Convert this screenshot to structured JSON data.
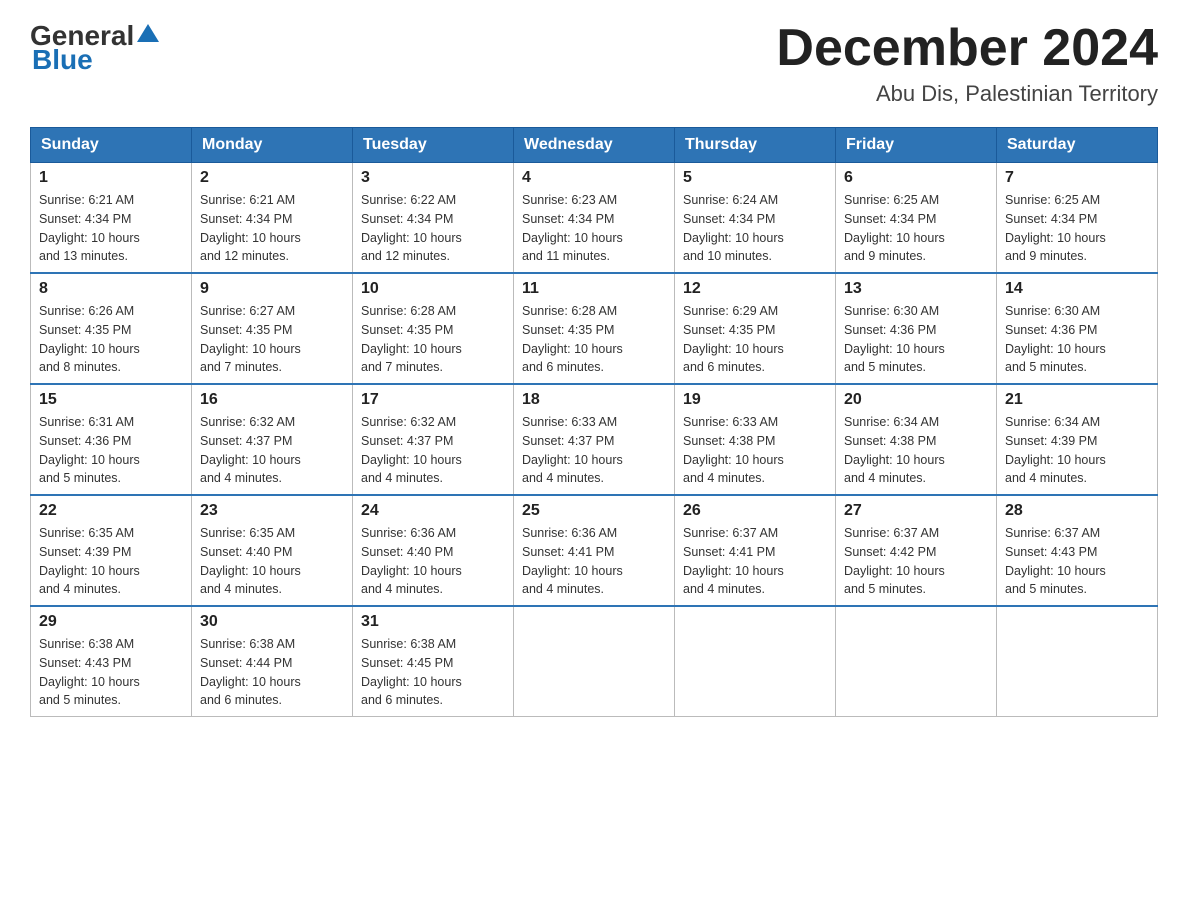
{
  "header": {
    "logo": {
      "text_general": "General",
      "text_blue": "Blue"
    },
    "title": "December 2024",
    "location": "Abu Dis, Palestinian Territory"
  },
  "calendar": {
    "days_of_week": [
      "Sunday",
      "Monday",
      "Tuesday",
      "Wednesday",
      "Thursday",
      "Friday",
      "Saturday"
    ],
    "weeks": [
      [
        {
          "day": "1",
          "sunrise": "6:21 AM",
          "sunset": "4:34 PM",
          "daylight": "10 hours and 13 minutes."
        },
        {
          "day": "2",
          "sunrise": "6:21 AM",
          "sunset": "4:34 PM",
          "daylight": "10 hours and 12 minutes."
        },
        {
          "day": "3",
          "sunrise": "6:22 AM",
          "sunset": "4:34 PM",
          "daylight": "10 hours and 12 minutes."
        },
        {
          "day": "4",
          "sunrise": "6:23 AM",
          "sunset": "4:34 PM",
          "daylight": "10 hours and 11 minutes."
        },
        {
          "day": "5",
          "sunrise": "6:24 AM",
          "sunset": "4:34 PM",
          "daylight": "10 hours and 10 minutes."
        },
        {
          "day": "6",
          "sunrise": "6:25 AM",
          "sunset": "4:34 PM",
          "daylight": "10 hours and 9 minutes."
        },
        {
          "day": "7",
          "sunrise": "6:25 AM",
          "sunset": "4:34 PM",
          "daylight": "10 hours and 9 minutes."
        }
      ],
      [
        {
          "day": "8",
          "sunrise": "6:26 AM",
          "sunset": "4:35 PM",
          "daylight": "10 hours and 8 minutes."
        },
        {
          "day": "9",
          "sunrise": "6:27 AM",
          "sunset": "4:35 PM",
          "daylight": "10 hours and 7 minutes."
        },
        {
          "day": "10",
          "sunrise": "6:28 AM",
          "sunset": "4:35 PM",
          "daylight": "10 hours and 7 minutes."
        },
        {
          "day": "11",
          "sunrise": "6:28 AM",
          "sunset": "4:35 PM",
          "daylight": "10 hours and 6 minutes."
        },
        {
          "day": "12",
          "sunrise": "6:29 AM",
          "sunset": "4:35 PM",
          "daylight": "10 hours and 6 minutes."
        },
        {
          "day": "13",
          "sunrise": "6:30 AM",
          "sunset": "4:36 PM",
          "daylight": "10 hours and 5 minutes."
        },
        {
          "day": "14",
          "sunrise": "6:30 AM",
          "sunset": "4:36 PM",
          "daylight": "10 hours and 5 minutes."
        }
      ],
      [
        {
          "day": "15",
          "sunrise": "6:31 AM",
          "sunset": "4:36 PM",
          "daylight": "10 hours and 5 minutes."
        },
        {
          "day": "16",
          "sunrise": "6:32 AM",
          "sunset": "4:37 PM",
          "daylight": "10 hours and 4 minutes."
        },
        {
          "day": "17",
          "sunrise": "6:32 AM",
          "sunset": "4:37 PM",
          "daylight": "10 hours and 4 minutes."
        },
        {
          "day": "18",
          "sunrise": "6:33 AM",
          "sunset": "4:37 PM",
          "daylight": "10 hours and 4 minutes."
        },
        {
          "day": "19",
          "sunrise": "6:33 AM",
          "sunset": "4:38 PM",
          "daylight": "10 hours and 4 minutes."
        },
        {
          "day": "20",
          "sunrise": "6:34 AM",
          "sunset": "4:38 PM",
          "daylight": "10 hours and 4 minutes."
        },
        {
          "day": "21",
          "sunrise": "6:34 AM",
          "sunset": "4:39 PM",
          "daylight": "10 hours and 4 minutes."
        }
      ],
      [
        {
          "day": "22",
          "sunrise": "6:35 AM",
          "sunset": "4:39 PM",
          "daylight": "10 hours and 4 minutes."
        },
        {
          "day": "23",
          "sunrise": "6:35 AM",
          "sunset": "4:40 PM",
          "daylight": "10 hours and 4 minutes."
        },
        {
          "day": "24",
          "sunrise": "6:36 AM",
          "sunset": "4:40 PM",
          "daylight": "10 hours and 4 minutes."
        },
        {
          "day": "25",
          "sunrise": "6:36 AM",
          "sunset": "4:41 PM",
          "daylight": "10 hours and 4 minutes."
        },
        {
          "day": "26",
          "sunrise": "6:37 AM",
          "sunset": "4:41 PM",
          "daylight": "10 hours and 4 minutes."
        },
        {
          "day": "27",
          "sunrise": "6:37 AM",
          "sunset": "4:42 PM",
          "daylight": "10 hours and 5 minutes."
        },
        {
          "day": "28",
          "sunrise": "6:37 AM",
          "sunset": "4:43 PM",
          "daylight": "10 hours and 5 minutes."
        }
      ],
      [
        {
          "day": "29",
          "sunrise": "6:38 AM",
          "sunset": "4:43 PM",
          "daylight": "10 hours and 5 minutes."
        },
        {
          "day": "30",
          "sunrise": "6:38 AM",
          "sunset": "4:44 PM",
          "daylight": "10 hours and 6 minutes."
        },
        {
          "day": "31",
          "sunrise": "6:38 AM",
          "sunset": "4:45 PM",
          "daylight": "10 hours and 6 minutes."
        },
        null,
        null,
        null,
        null
      ]
    ],
    "sunrise_label": "Sunrise:",
    "sunset_label": "Sunset:",
    "daylight_label": "Daylight:"
  }
}
